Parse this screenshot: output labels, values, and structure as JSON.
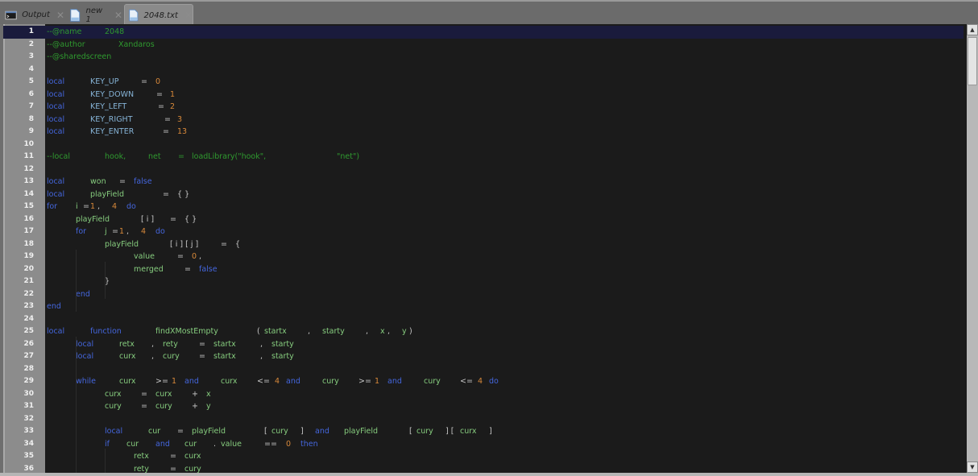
{
  "tabs": [
    {
      "label": "Output",
      "icon": "terminal-icon",
      "active": false
    },
    {
      "label": "new 1",
      "icon": "document-icon",
      "active": false
    },
    {
      "label": "2048.txt",
      "icon": "document-icon",
      "active": true
    }
  ],
  "colors": {
    "comment": "#2f9a2f",
    "keyword": "#4466dd",
    "identifier": "#86cc7e",
    "number": "#d8893a",
    "operator": "#c8c8c8",
    "constant": "#86b3d6",
    "editor_bg": "#1b1b1b",
    "current_line_bg": "#1a1b3c"
  },
  "editor": {
    "current_line": 1,
    "lines": [
      {
        "n": "1",
        "tokens": [
          [
            "c",
            "--@name",
            0
          ],
          [
            "c",
            "2048",
            72
          ]
        ]
      },
      {
        "n": "2",
        "tokens": [
          [
            "c",
            "--@author",
            0
          ],
          [
            "c",
            "Xandaros",
            89
          ]
        ]
      },
      {
        "n": "3",
        "tokens": [
          [
            "c",
            "--@sharedscreen",
            0
          ]
        ]
      },
      {
        "n": "4",
        "tokens": []
      },
      {
        "n": "5",
        "tokens": [
          [
            "k",
            "local",
            0
          ],
          [
            "kc",
            "KEY_UP",
            54
          ],
          [
            "o",
            "=",
            117
          ],
          [
            "n",
            "0",
            135
          ]
        ]
      },
      {
        "n": "6",
        "tokens": [
          [
            "k",
            "local",
            0
          ],
          [
            "kc",
            "KEY_DOWN",
            54
          ],
          [
            "o",
            "=",
            136
          ],
          [
            "n",
            "1",
            153
          ]
        ]
      },
      {
        "n": "7",
        "tokens": [
          [
            "k",
            "local",
            0
          ],
          [
            "kc",
            "KEY_LEFT",
            54
          ],
          [
            "o",
            "=",
            138
          ],
          [
            "n",
            "2",
            153
          ]
        ]
      },
      {
        "n": "8",
        "tokens": [
          [
            "k",
            "local",
            0
          ],
          [
            "kc",
            "KEY_RIGHT",
            54
          ],
          [
            "o",
            "=",
            146
          ],
          [
            "n",
            "3",
            162
          ]
        ]
      },
      {
        "n": "9",
        "tokens": [
          [
            "k",
            "local",
            0
          ],
          [
            "kc",
            "KEY_ENTER",
            54
          ],
          [
            "o",
            "=",
            144
          ],
          [
            "n",
            "13",
            162
          ]
        ]
      },
      {
        "n": "10",
        "tokens": []
      },
      {
        "n": "11",
        "tokens": [
          [
            "c",
            "--local",
            0
          ],
          [
            "c",
            "hook,",
            72
          ],
          [
            "c",
            "net",
            126
          ],
          [
            "c",
            "=",
            163
          ],
          [
            "c",
            "loadLibrary(\"hook\",",
            180
          ],
          [
            "c",
            "\"net\")",
            360
          ]
        ]
      },
      {
        "n": "12",
        "tokens": []
      },
      {
        "n": "13",
        "tokens": [
          [
            "k",
            "local",
            0
          ],
          [
            "i",
            "won",
            54
          ],
          [
            "o",
            "=",
            90
          ],
          [
            "k",
            "false",
            108
          ]
        ]
      },
      {
        "n": "14",
        "tokens": [
          [
            "k",
            "local",
            0
          ],
          [
            "i",
            "playField",
            54
          ],
          [
            "o",
            "=",
            144
          ],
          [
            "o",
            "{ }",
            162
          ]
        ]
      },
      {
        "n": "15",
        "tokens": [
          [
            "k",
            "for",
            0
          ],
          [
            "i",
            "i",
            36
          ],
          [
            "o",
            "=",
            45
          ],
          [
            "n",
            "1",
            54
          ],
          [
            "o",
            ",",
            63
          ],
          [
            "n",
            "4",
            81
          ],
          [
            "k",
            "do",
            99
          ]
        ]
      },
      {
        "n": "16",
        "tokens": [
          [
            "i",
            "playField",
            36
          ],
          [
            "o",
            "[ i ]",
            117
          ],
          [
            "o",
            "=",
            153
          ],
          [
            "o",
            "{ }",
            171
          ]
        ]
      },
      {
        "n": "17",
        "tokens": [
          [
            "k",
            "for",
            36
          ],
          [
            "i",
            "j",
            72
          ],
          [
            "o",
            "=",
            81
          ],
          [
            "n",
            "1",
            90
          ],
          [
            "o",
            ",",
            99
          ],
          [
            "n",
            "4",
            117
          ],
          [
            "k",
            "do",
            135
          ]
        ]
      },
      {
        "n": "18",
        "tokens": [
          [
            "i",
            "playField",
            72
          ],
          [
            "o",
            "[ i ] [ j ]",
            153
          ],
          [
            "o",
            "=",
            216
          ],
          [
            "o",
            "{",
            234
          ]
        ]
      },
      {
        "n": "19",
        "tokens": [
          [
            "i",
            "value",
            108
          ],
          [
            "o",
            "=",
            162
          ],
          [
            "n",
            "0",
            180
          ],
          [
            "o",
            ",",
            189
          ]
        ]
      },
      {
        "n": "20",
        "tokens": [
          [
            "i",
            "merged",
            108
          ],
          [
            "o",
            "=",
            171
          ],
          [
            "k",
            "false",
            189
          ]
        ]
      },
      {
        "n": "21",
        "tokens": [
          [
            "o",
            "}",
            72
          ]
        ]
      },
      {
        "n": "22",
        "tokens": [
          [
            "k",
            "end",
            36
          ]
        ]
      },
      {
        "n": "23",
        "tokens": [
          [
            "k",
            "end",
            0
          ]
        ]
      },
      {
        "n": "24",
        "tokens": []
      },
      {
        "n": "25",
        "tokens": [
          [
            "k",
            "local",
            0
          ],
          [
            "k",
            "function",
            54
          ],
          [
            "i",
            "findXMostEmpty",
            135
          ],
          [
            "o",
            "(",
            261
          ],
          [
            "i",
            "startx",
            270
          ],
          [
            "o",
            ",",
            324
          ],
          [
            "i",
            "starty",
            342
          ],
          [
            "o",
            ",",
            396
          ],
          [
            "i",
            "x",
            414
          ],
          [
            "o",
            ",",
            423
          ],
          [
            "i",
            "y",
            441
          ],
          [
            "o",
            ")",
            450
          ]
        ]
      },
      {
        "n": "26",
        "tokens": [
          [
            "k",
            "local",
            36
          ],
          [
            "i",
            "retx",
            90
          ],
          [
            "o",
            ",",
            130
          ],
          [
            "i",
            "rety",
            144
          ],
          [
            "o",
            "=",
            189
          ],
          [
            "i",
            "startx",
            207
          ],
          [
            "o",
            ",",
            265
          ],
          [
            "i",
            "starty",
            279
          ]
        ]
      },
      {
        "n": "27",
        "tokens": [
          [
            "k",
            "local",
            36
          ],
          [
            "i",
            "curx",
            90
          ],
          [
            "o",
            ",",
            130
          ],
          [
            "i",
            "cury",
            144
          ],
          [
            "o",
            "=",
            189
          ],
          [
            "i",
            "startx",
            207
          ],
          [
            "o",
            ",",
            265
          ],
          [
            "i",
            "starty",
            279
          ]
        ]
      },
      {
        "n": "28",
        "tokens": []
      },
      {
        "n": "29",
        "tokens": [
          [
            "k",
            "while",
            36
          ],
          [
            "i",
            "curx",
            90
          ],
          [
            "o",
            ">=",
            135
          ],
          [
            "n",
            "1",
            155
          ],
          [
            "k",
            "and",
            171
          ],
          [
            "i",
            "curx",
            216
          ],
          [
            "o",
            "<=",
            261
          ],
          [
            "n",
            "4",
            283
          ],
          [
            "k",
            "and",
            297
          ],
          [
            "i",
            "cury",
            342
          ],
          [
            "o",
            ">=",
            387
          ],
          [
            "n",
            "1",
            407
          ],
          [
            "k",
            "and",
            423
          ],
          [
            "i",
            "cury",
            468
          ],
          [
            "o",
            "<=",
            513
          ],
          [
            "n",
            "4",
            535
          ],
          [
            "k",
            "do",
            549
          ]
        ]
      },
      {
        "n": "30",
        "tokens": [
          [
            "i",
            "curx",
            72
          ],
          [
            "o",
            "=",
            117
          ],
          [
            "i",
            "curx",
            135
          ],
          [
            "o",
            "+",
            180
          ],
          [
            "i",
            "x",
            198
          ]
        ]
      },
      {
        "n": "31",
        "tokens": [
          [
            "i",
            "cury",
            72
          ],
          [
            "o",
            "=",
            117
          ],
          [
            "i",
            "cury",
            135
          ],
          [
            "o",
            "+",
            180
          ],
          [
            "i",
            "y",
            198
          ]
        ]
      },
      {
        "n": "32",
        "tokens": []
      },
      {
        "n": "33",
        "tokens": [
          [
            "k",
            "local",
            72
          ],
          [
            "i",
            "cur",
            126
          ],
          [
            "o",
            "=",
            162
          ],
          [
            "i",
            "playField",
            180
          ],
          [
            "o",
            "[",
            270
          ],
          [
            "i",
            "cury",
            279
          ],
          [
            "o",
            "]",
            315
          ],
          [
            "k",
            "and",
            333
          ],
          [
            "i",
            "playField",
            369
          ],
          [
            "o",
            "[",
            450
          ],
          [
            "i",
            "cury",
            459
          ],
          [
            "o",
            "] [",
            495
          ],
          [
            "i",
            "curx",
            513
          ],
          [
            "o",
            "]",
            549
          ]
        ]
      },
      {
        "n": "34",
        "tokens": [
          [
            "k",
            "if",
            72
          ],
          [
            "i",
            "cur",
            99
          ],
          [
            "k",
            "and",
            135
          ],
          [
            "i",
            "cur",
            171
          ],
          [
            "o",
            ".",
            207
          ],
          [
            "i",
            "value",
            216
          ],
          [
            "o",
            "==",
            270
          ],
          [
            "n",
            "0",
            297
          ],
          [
            "k",
            "then",
            315
          ]
        ]
      },
      {
        "n": "35",
        "tokens": [
          [
            "i",
            "retx",
            108
          ],
          [
            "o",
            "=",
            153
          ],
          [
            "i",
            "curx",
            171
          ]
        ]
      },
      {
        "n": "36",
        "tokens": [
          [
            "i",
            "rety",
            108
          ],
          [
            "o",
            "=",
            153
          ],
          [
            "i",
            "cury",
            171
          ]
        ]
      }
    ]
  },
  "scrollbar": {
    "up_icon": "▲",
    "down_icon": "▼",
    "position_fraction": 0.0
  }
}
